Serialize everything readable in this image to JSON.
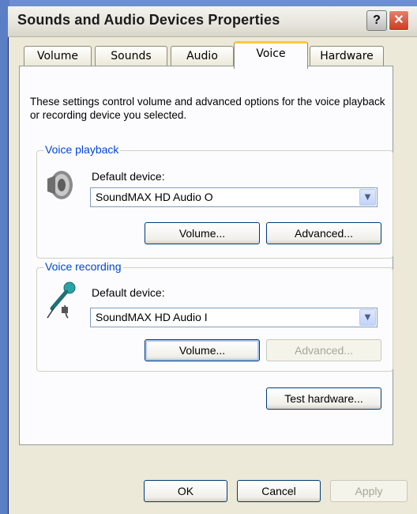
{
  "window": {
    "title": "Sounds and Audio Devices Properties",
    "help_label": "?",
    "close_label": "✕"
  },
  "tabs": [
    {
      "label": "Volume",
      "active": false
    },
    {
      "label": "Sounds",
      "active": false
    },
    {
      "label": "Audio",
      "active": false
    },
    {
      "label": "Voice",
      "active": true
    },
    {
      "label": "Hardware",
      "active": false
    }
  ],
  "description": "These settings control volume and advanced options for the voice playback or recording device you selected.",
  "voice_playback": {
    "group_label": "Voice playback",
    "default_device_label": "Default device:",
    "selected_device": "SoundMAX HD Audio O",
    "volume_button": "Volume...",
    "advanced_button": "Advanced...",
    "icon": "speaker-icon"
  },
  "voice_recording": {
    "group_label": "Voice recording",
    "default_device_label": "Default device:",
    "selected_device": "SoundMAX HD Audio I",
    "volume_button": "Volume...",
    "advanced_button": "Advanced...",
    "advanced_enabled": false,
    "icon": "microphone-icon"
  },
  "test_hardware_button": "Test hardware...",
  "footer": {
    "ok": "OK",
    "cancel": "Cancel",
    "apply": "Apply"
  },
  "colors": {
    "group_label": "#0046d5",
    "active_tab_accent": "#ffc83c",
    "close_button": "#c83c22"
  }
}
